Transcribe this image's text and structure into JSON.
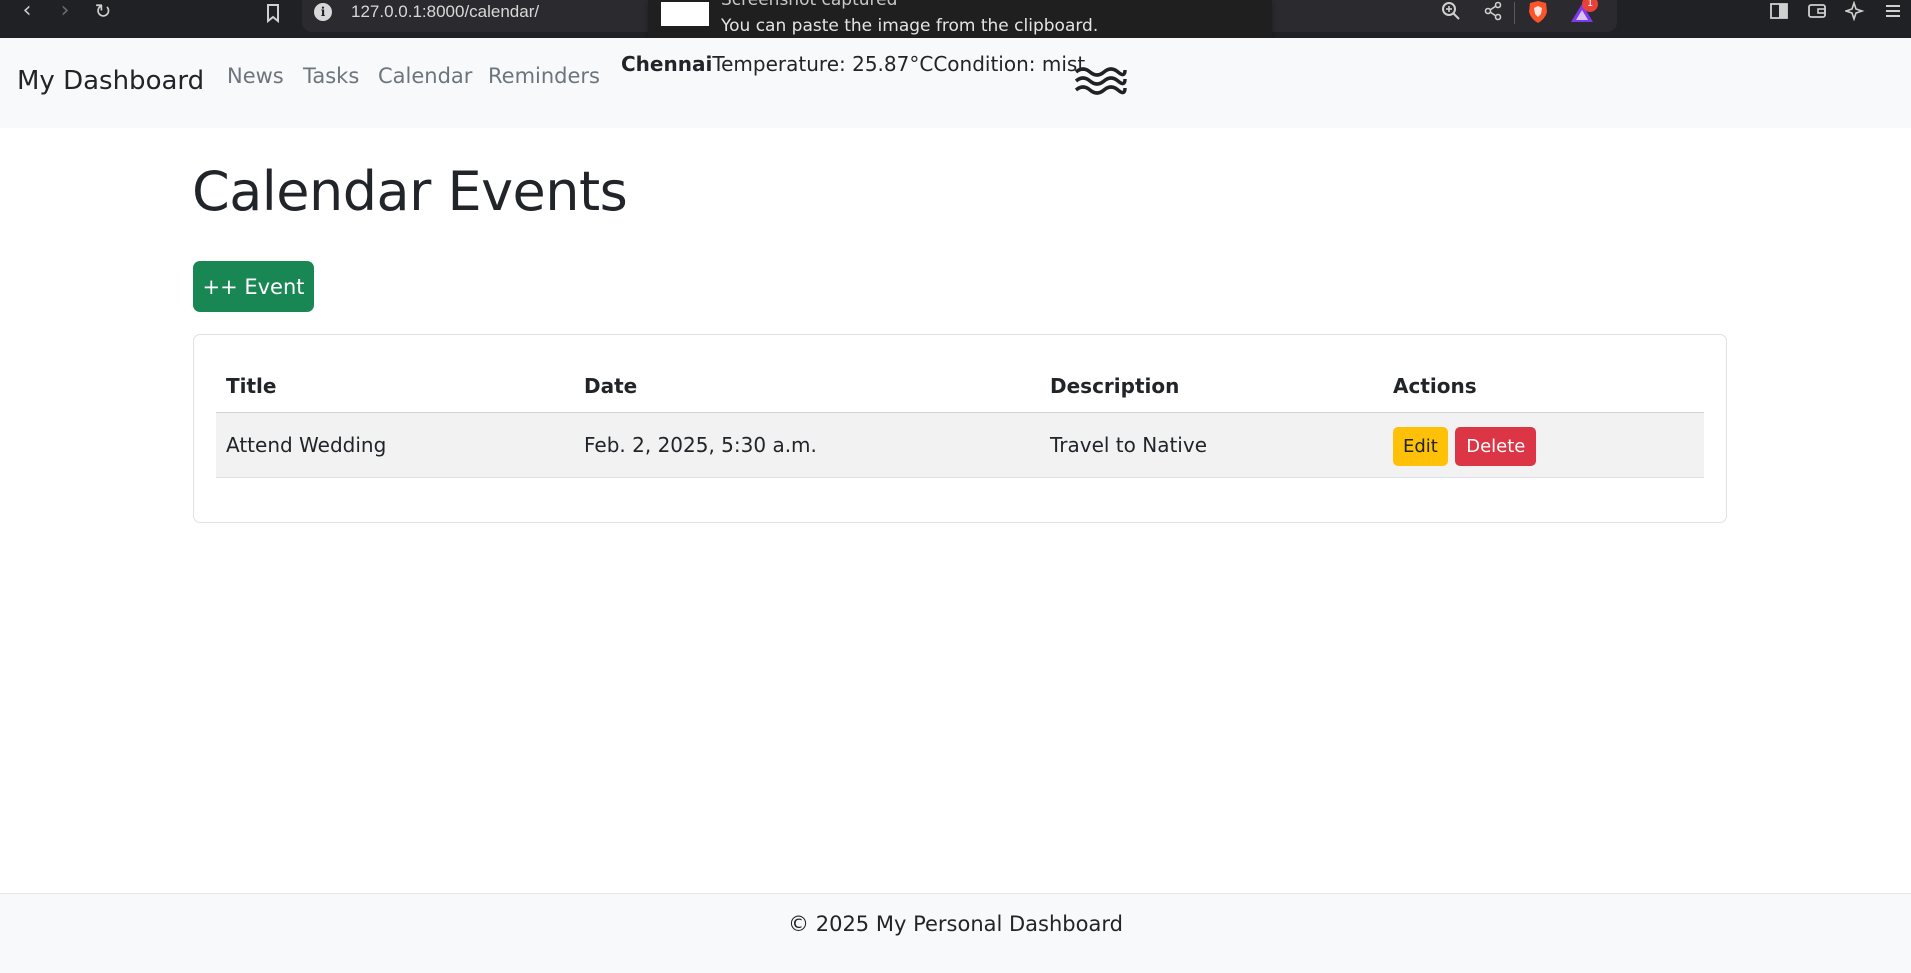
{
  "browser": {
    "url": "127.0.0.1:8000/calendar/",
    "rewards_count": "1"
  },
  "toast": {
    "title": "Screenshot captured",
    "message": "You can paste the image from the clipboard."
  },
  "navbar": {
    "brand": "My Dashboard",
    "links": [
      "News",
      "Tasks",
      "Calendar",
      "Reminders"
    ],
    "weather": {
      "city": "Chennai",
      "temperature": "Temperature: 25.87°C",
      "condition": "Condition: mist",
      "icon": "mist-icon"
    }
  },
  "main": {
    "title": "Calendar Events",
    "add_button": "++ Event",
    "table": {
      "headers": [
        "Title",
        "Date",
        "Description",
        "Actions"
      ],
      "rows": [
        {
          "title": "Attend Wedding",
          "date": "Feb. 2, 2025, 5:30 a.m.",
          "description": "Travel to Native",
          "edit_label": "Edit",
          "delete_label": "Delete"
        }
      ]
    }
  },
  "footer": {
    "text": "© 2025 My Personal Dashboard"
  },
  "colors": {
    "success": "#198754",
    "warning": "#ffc107",
    "danger": "#dc3545",
    "navbar_bg": "#f8f9fa"
  }
}
